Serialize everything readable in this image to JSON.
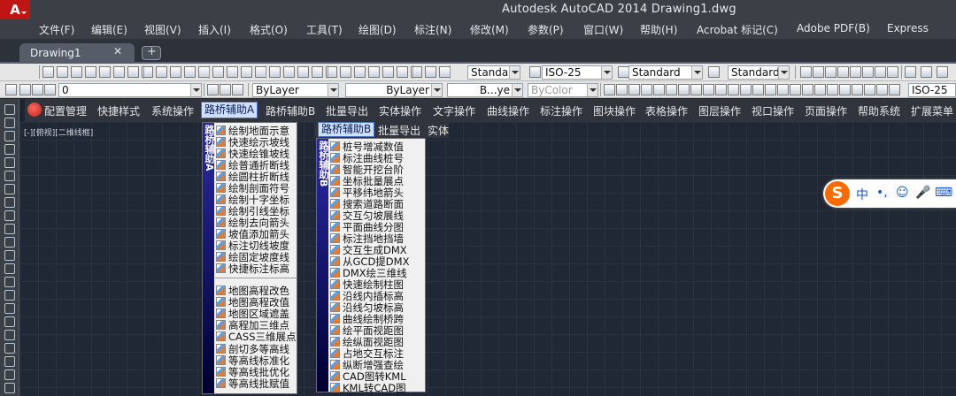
{
  "titlebar": {
    "app_logo": "A",
    "title": "Autodesk AutoCAD 2014     Drawing1.dwg"
  },
  "menubar": {
    "items": [
      "文件(F)",
      "编辑(E)",
      "视图(V)",
      "插入(I)",
      "格式(O)",
      "工具(T)",
      "绘图(D)",
      "标注(N)",
      "修改(M)",
      "参数(P)",
      "窗口(W)",
      "帮助(H)",
      "Acrobat 标记(C)",
      "Adobe PDF(B)",
      "Express"
    ]
  },
  "tabs": {
    "document": "Drawing1",
    "close": "✕"
  },
  "toolbar1": {
    "text_style": "Standard",
    "dim_style": "ISO-25",
    "table_style": "Standard",
    "mleader_style": "Standard"
  },
  "toolbar2": {
    "layer": "0",
    "color": "ByLayer",
    "linetype": "ByLayer",
    "lineweight": "B...ye",
    "plotstyle": "ByColor",
    "dim_style": "ISO-25"
  },
  "plugin_menu": {
    "items": [
      "配置管理",
      "快捷样式",
      "系统操作",
      "路桥辅助A",
      "路桥辅助B",
      "批量导出",
      "实体操作",
      "文字操作",
      "曲线操作",
      "标注操作",
      "图块操作",
      "表格操作",
      "图层操作",
      "视口操作",
      "页面操作",
      "帮助系统",
      "扩展菜单"
    ],
    "active_index": 3
  },
  "viewport_label": "[-][俯视][二维线框]",
  "menu_a": {
    "strip": "路桥辅助A",
    "group1": [
      "绘制地面示意",
      "快速绘示坡线",
      "快速绘锥坡线",
      "绘普通折断线",
      "绘圆柱折断线",
      "绘制剖面符号",
      "绘制十字坐标",
      "绘制引线坐标",
      "绘制去向箭头",
      "坡值添加箭头",
      "标注切线坡度",
      "绘固定坡度线",
      "快捷标注标高"
    ],
    "group2": [
      "地图高程改色",
      "地图高程改值",
      "地图区域遮盖",
      "高程加三维点",
      "CASS三维展点",
      "剖切多等高线",
      "等高线标准化",
      "等高线批优化",
      "等高线批赋值"
    ]
  },
  "menu_b": {
    "tabs": [
      "路桥辅助B",
      "批量导出",
      "实体"
    ],
    "strip": "路桥辅助B",
    "items": [
      "桩号增减数值",
      "标注曲线桩号",
      "智能开挖台阶",
      "坐标批量展点",
      "平移纬地箭头",
      "搜索道路断面",
      "交互匀坡展线",
      "平面曲线分图",
      "标注挡地挡墙",
      "交互生成DMX",
      "从GCD提DMX",
      "DMX绘三维线",
      "快速绘制柱图",
      "沿线内插标高",
      "沿线匀坡标高",
      "曲线绘制桥跨",
      "绘平面视距图",
      "绘纵面视距图",
      "占地交互标注",
      "纵断增强查绘",
      "CAD图转KML",
      "KML转CAD图"
    ]
  },
  "ime": {
    "logo": "S",
    "mode": "中",
    "punct": "•,",
    "emoji": "☺",
    "voice": "🎤",
    "kbd": "⌨"
  }
}
